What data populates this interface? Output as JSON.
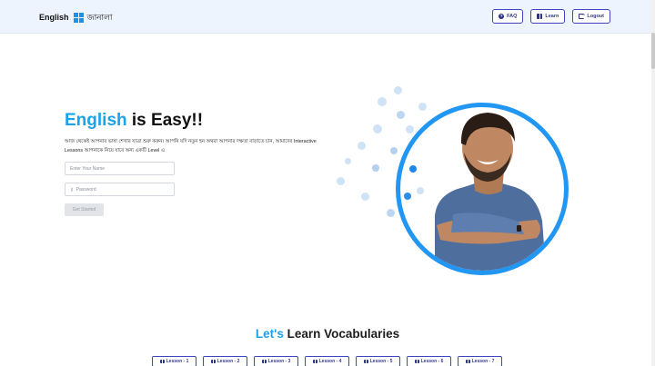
{
  "brand": {
    "text_en": "English",
    "text_bn": "জানালা",
    "logo_icon": "windows-logo-icon"
  },
  "nav": {
    "faq_label": "FAQ",
    "learn_label": "Learn",
    "logout_label": "Logout"
  },
  "hero": {
    "title_accent": "English",
    "title_rest": " is Easy!!",
    "description": "আজ থেকেই আপনার ভাষা শেখার যাত্রা শুরু করুন। আপনি যদি নতুন হন অথবা আপনার দক্ষতা বাড়াতে চান, আমাদের Interactive Lessons আপনাকে নিয়ে যাবে অন্য একটি Level এ",
    "name_placeholder": "Enter Your Name",
    "password_placeholder": "Password",
    "start_label": "Get Started"
  },
  "vocab": {
    "title_accent": "Let's",
    "title_rest": " Learn Vocabularies",
    "lessons": [
      "Lesson - 1",
      "Lesson - 2",
      "Lesson - 3",
      "Lesson - 4",
      "Lesson - 5",
      "Lesson - 6",
      "Lesson - 7"
    ]
  },
  "colors": {
    "accent": "#1aa3e8",
    "nav_bg": "#eef4fd",
    "button_border": "#3a46c2",
    "circle_border": "#2196f3"
  }
}
